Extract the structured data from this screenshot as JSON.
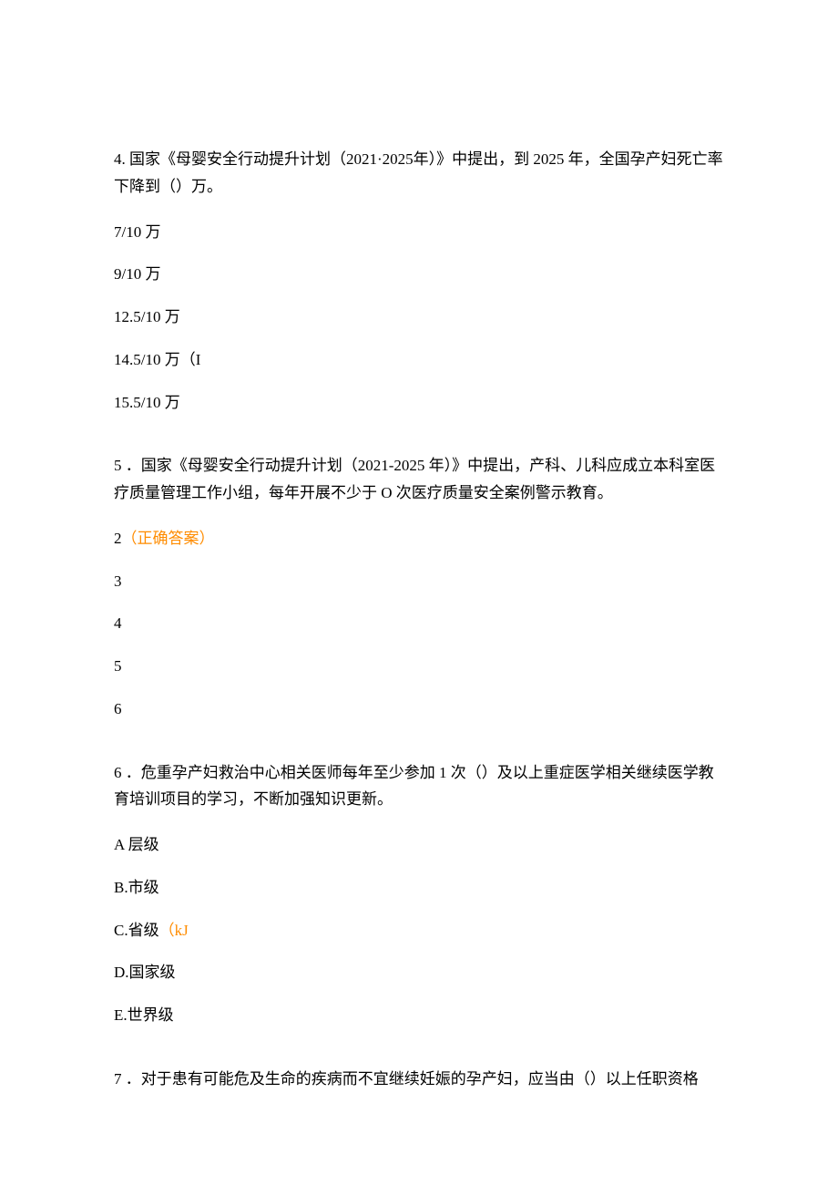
{
  "q4": {
    "stem": "4. 国家《母婴安全行动提升计划（2021·2025年）》中提出，到 2025 年，全国孕产妇死亡率下降到（）万。",
    "options": [
      "7/10 万",
      "9/10 万",
      "12.5/10 万",
      "14.5/10 万（I",
      "15.5/10 万"
    ]
  },
  "q5": {
    "stem": "5 ．国家《母婴安全行动提升计划（2021-2025 年）》中提出，产科、儿科应成立本科室医疗质量管理工作小组，每年开展不少于 O 次医疗质量安全案例警示教育。",
    "optionA_value": "2",
    "optionA_hint": "（正确答案）",
    "options_rest": [
      "3",
      "4",
      "5",
      "6"
    ]
  },
  "q6": {
    "stem": "6 ．危重孕产妇救治中心相关医师每年至少参加 1 次（）及以上重症医学相关继续医学教育培训项目的学习，不断加强知识更新。",
    "optionA": "A 层级",
    "optionB": "B.市级",
    "optionC_label": "C.省级",
    "optionC_hint": "（kJ",
    "optionD": "D.国家级",
    "optionE": "E.世界级"
  },
  "q7": {
    "stem": "7 ．对于患有可能危及生命的疾病而不宜继续妊娠的孕产妇，应当由（）以上任职资格"
  }
}
